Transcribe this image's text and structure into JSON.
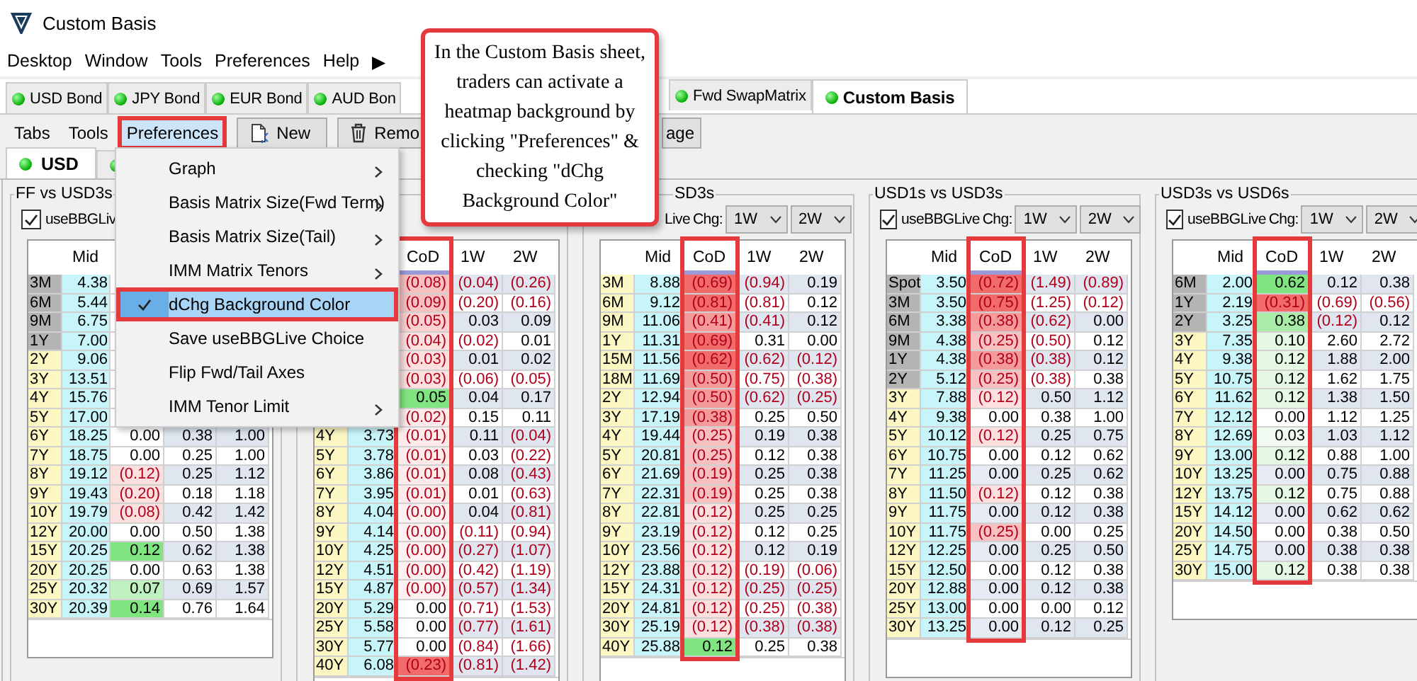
{
  "window": {
    "title": "Custom Basis"
  },
  "menubar": [
    "Desktop",
    "Window",
    "Tools",
    "Preferences",
    "Help",
    "▶"
  ],
  "tab_groups": [
    [
      {
        "label": "USD Bond",
        "selected": false
      },
      {
        "label": "JPY Bond",
        "selected": false
      },
      {
        "label": "EUR Bond",
        "selected": false
      },
      {
        "label": "AUD Bon",
        "selected": false
      }
    ],
    [
      {
        "label": "Fwd SwapMatrix",
        "selected": false
      },
      {
        "label": "Custom Basis",
        "selected": true
      }
    ]
  ],
  "toolbar": {
    "menus": [
      {
        "label": "Tabs",
        "highlighted": false
      },
      {
        "label": "Tools",
        "highlighted": false
      },
      {
        "label": "Preferences",
        "highlighted": true
      }
    ],
    "buttons": [
      {
        "label": "New",
        "kind": "new"
      },
      {
        "label": "Remo",
        "kind": "trash"
      },
      {
        "label": "age",
        "kind": "plain"
      }
    ]
  },
  "subtabs": [
    {
      "label": "USD",
      "selected": true
    },
    {
      "selected": false
    }
  ],
  "panels": [
    {
      "title": "FF vs USD3s",
      "title_cut": false,
      "checkbox": {
        "label": "useBBGLiv",
        "checked": true
      },
      "headers": {
        "mid": "Mid"
      },
      "cod_highlighted": false,
      "rows": [
        {
          "tenor": "3M",
          "kind": "money",
          "mid": "4.38"
        },
        {
          "tenor": "6M",
          "kind": "money",
          "mid": "5.44"
        },
        {
          "tenor": "9M",
          "kind": "money",
          "mid": "6.75"
        },
        {
          "tenor": "1Y",
          "kind": "money",
          "mid": "7.00"
        },
        {
          "tenor": "2Y",
          "kind": "swap",
          "mid": "9.06"
        },
        {
          "tenor": "3Y",
          "kind": "swap",
          "mid": "13.51"
        },
        {
          "tenor": "4Y",
          "kind": "swap",
          "mid": "15.76"
        },
        {
          "tenor": "5Y",
          "kind": "swap",
          "mid": "17.00"
        },
        {
          "tenor": "6Y",
          "kind": "swap",
          "mid": "18.25",
          "cod": "0.00",
          "color": "#ffffff",
          "w1": "0.38",
          "w2": "1.00",
          "neg": [
            false,
            false,
            false
          ]
        },
        {
          "tenor": "7Y",
          "kind": "swap",
          "mid": "18.75",
          "cod": "0.00",
          "color": "#ffffff",
          "w1": "0.25",
          "w2": "1.00",
          "neg": [
            false,
            false,
            false
          ]
        },
        {
          "tenor": "8Y",
          "kind": "swap",
          "mid": "19.12",
          "cod": "(0.12)",
          "color": "#fce0e0",
          "w1": "0.25",
          "w2": "1.12",
          "neg": [
            true,
            false,
            false
          ]
        },
        {
          "tenor": "9Y",
          "kind": "swap",
          "mid": "19.43",
          "cod": "(0.20)",
          "color": "#fce0e0",
          "w1": "0.18",
          "w2": "1.18",
          "neg": [
            true,
            false,
            false
          ]
        },
        {
          "tenor": "10Y",
          "kind": "swap",
          "mid": "19.79",
          "cod": "(0.08)",
          "color": "#fce0e0",
          "w1": "0.42",
          "w2": "1.42",
          "neg": [
            true,
            false,
            false
          ]
        },
        {
          "tenor": "12Y",
          "kind": "swap",
          "mid": "20.00",
          "cod": "0.00",
          "color": "#ffffff",
          "w1": "0.50",
          "w2": "1.38",
          "neg": [
            false,
            false,
            false
          ]
        },
        {
          "tenor": "15Y",
          "kind": "swap",
          "mid": "20.25",
          "cod": "0.12",
          "color": "#80e480",
          "w1": "0.62",
          "w2": "1.38",
          "neg": [
            false,
            false,
            false
          ]
        },
        {
          "tenor": "20Y",
          "kind": "swap",
          "mid": "20.25",
          "cod": "0.00",
          "color": "#ffffff",
          "w1": "0.63",
          "w2": "1.38",
          "neg": [
            false,
            false,
            false
          ]
        },
        {
          "tenor": "25Y",
          "kind": "swap",
          "mid": "20.32",
          "cod": "0.07",
          "color": "#bff0bf",
          "w1": "0.69",
          "w2": "1.57",
          "neg": [
            false,
            false,
            false
          ]
        },
        {
          "tenor": "30Y",
          "kind": "swap",
          "mid": "20.39",
          "cod": "0.14",
          "color": "#80e480",
          "w1": "0.76",
          "w2": "1.64",
          "neg": [
            false,
            false,
            false
          ]
        }
      ]
    },
    {
      "headers": {
        "cod": "CoD",
        "w1": "1W",
        "w2": "2W"
      },
      "cod_highlighted": true,
      "rows": [
        {
          "cod": "(0.08)",
          "color": "#f8c0c0",
          "w1": "(0.04)",
          "w2": "(0.26)",
          "neg": [
            true,
            true,
            true
          ]
        },
        {
          "cod": "(0.09)",
          "color": "#f8c0c0",
          "w1": "(0.20)",
          "w2": "(0.16)",
          "neg": [
            true,
            true,
            true
          ]
        },
        {
          "cod": "(0.05)",
          "color": "#fad0d0",
          "w1": "0.03",
          "w2": "0.09",
          "neg": [
            true,
            false,
            false
          ]
        },
        {
          "cod": "(0.04)",
          "color": "#fce0e0",
          "w1": "(0.02)",
          "w2": "0.01",
          "neg": [
            true,
            true,
            false
          ]
        },
        {
          "cod": "(0.03)",
          "color": "#fce0e0",
          "w1": "0.01",
          "w2": "0.02",
          "neg": [
            true,
            false,
            false
          ]
        },
        {
          "cod": "(0.03)",
          "color": "#fce0e0",
          "w1": "(0.06)",
          "w2": "(0.05)",
          "neg": [
            true,
            true,
            true
          ]
        },
        {
          "cod": "0.05",
          "color": "#80e480",
          "w1": "0.04",
          "w2": "0.17",
          "neg": [
            false,
            false,
            false
          ]
        },
        {
          "cod": "(0.02)",
          "color": "#fdeaea",
          "w1": "0.15",
          "w2": "0.11",
          "neg": [
            true,
            false,
            false
          ]
        },
        {
          "tenor": "4Y",
          "kind": "swap",
          "mid": "3.73",
          "cod": "(0.01)",
          "color": "#fdeaea",
          "w1": "0.11",
          "w2": "(0.04)",
          "neg": [
            true,
            false,
            true
          ]
        },
        {
          "tenor": "5Y",
          "kind": "swap",
          "mid": "3.78",
          "cod": "(0.01)",
          "color": "#fdeaea",
          "w1": "0.03",
          "w2": "(0.22)",
          "neg": [
            true,
            false,
            true
          ]
        },
        {
          "tenor": "6Y",
          "kind": "swap",
          "mid": "3.86",
          "cod": "(0.01)",
          "color": "#fdeaea",
          "w1": "0.08",
          "w2": "(0.43)",
          "neg": [
            true,
            false,
            true
          ]
        },
        {
          "tenor": "7Y",
          "kind": "swap",
          "mid": "3.95",
          "cod": "(0.01)",
          "color": "#fdeaea",
          "w1": "0.01",
          "w2": "(0.63)",
          "neg": [
            true,
            false,
            true
          ]
        },
        {
          "tenor": "8Y",
          "kind": "swap",
          "mid": "4.04",
          "cod": "(0.00)",
          "color": "#fdf0f0",
          "w1": "0.04",
          "w2": "(0.81)",
          "neg": [
            true,
            false,
            true
          ]
        },
        {
          "tenor": "9Y",
          "kind": "swap",
          "mid": "4.14",
          "cod": "(0.00)",
          "color": "#fdf0f0",
          "w1": "(0.11)",
          "w2": "(0.94)",
          "neg": [
            true,
            true,
            true
          ]
        },
        {
          "tenor": "10Y",
          "kind": "swap",
          "mid": "4.25",
          "cod": "(0.00)",
          "color": "#fdf0f0",
          "w1": "(0.27)",
          "w2": "(1.07)",
          "neg": [
            true,
            true,
            true
          ]
        },
        {
          "tenor": "12Y",
          "kind": "swap",
          "mid": "4.51",
          "cod": "(0.00)",
          "color": "#fdf0f0",
          "w1": "(0.42)",
          "w2": "(1.19)",
          "neg": [
            true,
            true,
            true
          ]
        },
        {
          "tenor": "15Y",
          "kind": "swap",
          "mid": "4.87",
          "cod": "(0.00)",
          "color": "#fdf0f0",
          "w1": "(0.57)",
          "w2": "(1.34)",
          "neg": [
            true,
            true,
            true
          ]
        },
        {
          "tenor": "20Y",
          "kind": "swap",
          "mid": "5.29",
          "cod": "0.00",
          "color": "#ffffff",
          "w1": "(0.71)",
          "w2": "(1.53)",
          "neg": [
            false,
            true,
            true
          ]
        },
        {
          "tenor": "25Y",
          "kind": "swap",
          "mid": "5.58",
          "cod": "0.00",
          "color": "#ffffff",
          "w1": "(0.77)",
          "w2": "(1.61)",
          "neg": [
            false,
            true,
            true
          ]
        },
        {
          "tenor": "30Y",
          "kind": "swap",
          "mid": "5.77",
          "cod": "0.00",
          "color": "#ffffff",
          "w1": "(0.84)",
          "w2": "(1.66)",
          "neg": [
            false,
            true,
            true
          ]
        },
        {
          "tenor": "40Y",
          "kind": "swap",
          "mid": "6.08",
          "cod": "(0.23)",
          "color": "#f26b6b",
          "w1": "(0.81)",
          "w2": "(1.42)",
          "neg": [
            true,
            true,
            true
          ]
        }
      ]
    },
    {
      "title": "SD3s",
      "title_cut": true,
      "checkbox": {
        "label": "Live"
      },
      "chg_label": "Chg:",
      "dropdowns": [
        "1W",
        "2W"
      ],
      "headers": {
        "mid": "Mid",
        "cod": "CoD",
        "w1": "1W",
        "w2": "2W"
      },
      "cod_highlighted": true,
      "rows": [
        {
          "tenor": "3M",
          "kind": "swap",
          "mid": "8.88",
          "cod": "(0.69)",
          "color": "#f26b6b",
          "w1": "(0.94)",
          "w2": "0.19",
          "neg": [
            true,
            true,
            false
          ]
        },
        {
          "tenor": "6M",
          "kind": "swap",
          "mid": "9.12",
          "cod": "(0.81)",
          "color": "#f26b6b",
          "w1": "(0.81)",
          "w2": "0.12",
          "neg": [
            true,
            true,
            false
          ]
        },
        {
          "tenor": "9M",
          "kind": "swap",
          "mid": "11.06",
          "cod": "(0.41)",
          "color": "#f59a9a",
          "w1": "(0.41)",
          "w2": "0.12",
          "neg": [
            true,
            true,
            false
          ]
        },
        {
          "tenor": "1Y",
          "kind": "swap",
          "mid": "11.31",
          "cod": "(0.69)",
          "color": "#f26b6b",
          "w1": "0.31",
          "w2": "0.00",
          "neg": [
            true,
            false,
            false
          ]
        },
        {
          "tenor": "15M",
          "kind": "swap",
          "mid": "11.56",
          "cod": "(0.62)",
          "color": "#f26b6b",
          "w1": "(0.62)",
          "w2": "(0.12)",
          "neg": [
            true,
            true,
            true
          ]
        },
        {
          "tenor": "18M",
          "kind": "swap",
          "mid": "11.69",
          "cod": "(0.50)",
          "color": "#f59a9a",
          "w1": "(0.75)",
          "w2": "(0.38)",
          "neg": [
            true,
            true,
            true
          ]
        },
        {
          "tenor": "2Y",
          "kind": "swap",
          "mid": "12.94",
          "cod": "(0.50)",
          "color": "#f59a9a",
          "w1": "(0.62)",
          "w2": "(0.25)",
          "neg": [
            true,
            true,
            true
          ]
        },
        {
          "tenor": "3Y",
          "kind": "swap",
          "mid": "17.19",
          "cod": "(0.38)",
          "color": "#f59a9a",
          "w1": "0.25",
          "w2": "0.50",
          "neg": [
            true,
            false,
            false
          ]
        },
        {
          "tenor": "4Y",
          "kind": "swap",
          "mid": "19.44",
          "cod": "(0.25)",
          "color": "#f8c0c0",
          "w1": "0.19",
          "w2": "0.38",
          "neg": [
            true,
            false,
            false
          ]
        },
        {
          "tenor": "5Y",
          "kind": "swap",
          "mid": "20.81",
          "cod": "(0.25)",
          "color": "#f8c0c0",
          "w1": "0.12",
          "w2": "0.38",
          "neg": [
            true,
            false,
            false
          ]
        },
        {
          "tenor": "6Y",
          "kind": "swap",
          "mid": "21.69",
          "cod": "(0.19)",
          "color": "#f8c0c0",
          "w1": "0.25",
          "w2": "0.38",
          "neg": [
            true,
            false,
            false
          ]
        },
        {
          "tenor": "7Y",
          "kind": "swap",
          "mid": "22.31",
          "cod": "(0.19)",
          "color": "#f8c0c0",
          "w1": "0.25",
          "w2": "0.38",
          "neg": [
            true,
            false,
            false
          ]
        },
        {
          "tenor": "8Y",
          "kind": "swap",
          "mid": "22.81",
          "cod": "(0.12)",
          "color": "#fce0e0",
          "w1": "0.25",
          "w2": "0.25",
          "neg": [
            true,
            false,
            false
          ]
        },
        {
          "tenor": "9Y",
          "kind": "swap",
          "mid": "23.19",
          "cod": "(0.12)",
          "color": "#fce0e0",
          "w1": "0.12",
          "w2": "0.25",
          "neg": [
            true,
            false,
            false
          ]
        },
        {
          "tenor": "10Y",
          "kind": "swap",
          "mid": "23.56",
          "cod": "(0.12)",
          "color": "#fce0e0",
          "w1": "0.12",
          "w2": "0.19",
          "neg": [
            true,
            false,
            false
          ]
        },
        {
          "tenor": "12Y",
          "kind": "swap",
          "mid": "23.88",
          "cod": "(0.12)",
          "color": "#fce0e0",
          "w1": "(0.19)",
          "w2": "(0.06)",
          "neg": [
            true,
            true,
            true
          ]
        },
        {
          "tenor": "15Y",
          "kind": "swap",
          "mid": "24.31",
          "cod": "(0.12)",
          "color": "#fce0e0",
          "w1": "(0.25)",
          "w2": "(0.25)",
          "neg": [
            true,
            true,
            true
          ]
        },
        {
          "tenor": "20Y",
          "kind": "swap",
          "mid": "24.81",
          "cod": "(0.12)",
          "color": "#fce0e0",
          "w1": "(0.25)",
          "w2": "(0.38)",
          "neg": [
            true,
            true,
            true
          ]
        },
        {
          "tenor": "30Y",
          "kind": "swap",
          "mid": "25.19",
          "cod": "(0.12)",
          "color": "#fce0e0",
          "w1": "(0.38)",
          "w2": "(0.38)",
          "neg": [
            true,
            true,
            true
          ]
        },
        {
          "tenor": "40Y",
          "kind": "swap",
          "mid": "25.88",
          "cod": "0.12",
          "color": "#80e480",
          "w1": "0.25",
          "w2": "0.38",
          "neg": [
            false,
            false,
            false
          ]
        }
      ]
    },
    {
      "title": "USD1s vs USD3s",
      "title_cut": false,
      "checkbox": {
        "label": "useBBGLive",
        "checked": true
      },
      "chg_label": "Chg:",
      "dropdowns": [
        "1W",
        "2W"
      ],
      "headers": {
        "mid": "Mid",
        "cod": "CoD",
        "w1": "1W",
        "w2": "2W"
      },
      "cod_highlighted": true,
      "rows": [
        {
          "tenor": "Spot",
          "kind": "money",
          "mid": "3.50",
          "cod": "(0.72)",
          "color": "#f26b6b",
          "w1": "(1.49)",
          "w2": "(0.89)",
          "neg": [
            true,
            true,
            true
          ]
        },
        {
          "tenor": "3M",
          "kind": "money",
          "mid": "3.50",
          "cod": "(0.75)",
          "color": "#f26b6b",
          "w1": "(1.25)",
          "w2": "(0.12)",
          "neg": [
            true,
            true,
            true
          ]
        },
        {
          "tenor": "6M",
          "kind": "money",
          "mid": "3.38",
          "cod": "(0.38)",
          "color": "#f59a9a",
          "w1": "(0.62)",
          "w2": "0.00",
          "neg": [
            true,
            true,
            false
          ]
        },
        {
          "tenor": "9M",
          "kind": "money",
          "mid": "4.38",
          "cod": "(0.25)",
          "color": "#f8c0c0",
          "w1": "(0.50)",
          "w2": "0.12",
          "neg": [
            true,
            true,
            false
          ]
        },
        {
          "tenor": "1Y",
          "kind": "money",
          "mid": "4.38",
          "cod": "(0.38)",
          "color": "#f59a9a",
          "w1": "(0.38)",
          "w2": "0.12",
          "neg": [
            true,
            true,
            false
          ]
        },
        {
          "tenor": "2Y",
          "kind": "money",
          "mid": "5.12",
          "cod": "(0.25)",
          "color": "#f8c0c0",
          "w1": "(0.38)",
          "w2": "0.38",
          "neg": [
            true,
            true,
            false
          ]
        },
        {
          "tenor": "3Y",
          "kind": "swap",
          "mid": "7.88",
          "cod": "(0.12)",
          "color": "#fce0e0",
          "w1": "0.50",
          "w2": "1.12",
          "neg": [
            true,
            false,
            false
          ]
        },
        {
          "tenor": "4Y",
          "kind": "swap",
          "mid": "9.38",
          "cod": "0.00",
          "color": "#ffffff",
          "w1": "0.38",
          "w2": "1.00",
          "neg": [
            false,
            false,
            false
          ]
        },
        {
          "tenor": "5Y",
          "kind": "swap",
          "mid": "10.12",
          "cod": "(0.12)",
          "color": "#fce0e0",
          "w1": "0.25",
          "w2": "0.75",
          "neg": [
            true,
            false,
            false
          ]
        },
        {
          "tenor": "6Y",
          "kind": "swap",
          "mid": "10.75",
          "cod": "0.00",
          "color": "#ffffff",
          "w1": "0.12",
          "w2": "0.62",
          "neg": [
            false,
            false,
            false
          ]
        },
        {
          "tenor": "7Y",
          "kind": "swap",
          "mid": "11.25",
          "cod": "0.00",
          "color": "#e6ebf3",
          "w1": "0.25",
          "w2": "0.62",
          "neg": [
            false,
            false,
            false
          ]
        },
        {
          "tenor": "8Y",
          "kind": "swap",
          "mid": "11.50",
          "cod": "(0.12)",
          "color": "#fce0e0",
          "w1": "0.12",
          "w2": "0.38",
          "neg": [
            true,
            false,
            false
          ]
        },
        {
          "tenor": "9Y",
          "kind": "swap",
          "mid": "11.75",
          "cod": "0.00",
          "color": "#e6ebf3",
          "w1": "0.12",
          "w2": "0.38",
          "neg": [
            false,
            false,
            false
          ]
        },
        {
          "tenor": "10Y",
          "kind": "swap",
          "mid": "11.75",
          "cod": "(0.25)",
          "color": "#f8c0c0",
          "w1": "0.00",
          "w2": "0.25",
          "neg": [
            true,
            false,
            false
          ]
        },
        {
          "tenor": "12Y",
          "kind": "swap",
          "mid": "12.25",
          "cod": "0.00",
          "color": "#e6ebf3",
          "w1": "0.25",
          "w2": "0.50",
          "neg": [
            false,
            false,
            false
          ]
        },
        {
          "tenor": "15Y",
          "kind": "swap",
          "mid": "12.50",
          "cod": "0.00",
          "color": "#ffffff",
          "w1": "0.12",
          "w2": "0.38",
          "neg": [
            false,
            false,
            false
          ]
        },
        {
          "tenor": "20Y",
          "kind": "swap",
          "mid": "12.88",
          "cod": "0.00",
          "color": "#e6ebf3",
          "w1": "0.12",
          "w2": "0.38",
          "neg": [
            false,
            false,
            false
          ]
        },
        {
          "tenor": "25Y",
          "kind": "swap",
          "mid": "13.00",
          "cod": "0.00",
          "color": "#ffffff",
          "w1": "0.00",
          "w2": "0.12",
          "neg": [
            false,
            false,
            false
          ]
        },
        {
          "tenor": "30Y",
          "kind": "swap",
          "mid": "13.25",
          "cod": "0.00",
          "color": "#e6ebf3",
          "w1": "0.12",
          "w2": "0.25",
          "neg": [
            false,
            false,
            false
          ]
        }
      ]
    },
    {
      "title": "USD3s vs USD6s",
      "title_cut": false,
      "checkbox": {
        "label": "useBBGLive",
        "checked": true
      },
      "chg_label": "Chg:",
      "dropdowns": [
        "1W",
        "2W"
      ],
      "headers": {
        "mid": "Mid",
        "cod": "CoD",
        "w1": "1W",
        "w2": "2W"
      },
      "cod_highlighted": true,
      "rows": [
        {
          "tenor": "6M",
          "kind": "money",
          "mid": "2.00",
          "cod": "0.62",
          "color": "#80e480",
          "w1": "0.12",
          "w2": "0.38",
          "neg": [
            false,
            false,
            false
          ]
        },
        {
          "tenor": "1Y",
          "kind": "money",
          "mid": "2.19",
          "cod": "(0.31)",
          "color": "#f26b6b",
          "w1": "(0.69)",
          "w2": "(0.56)",
          "neg": [
            true,
            true,
            true
          ]
        },
        {
          "tenor": "2Y",
          "kind": "money",
          "mid": "3.25",
          "cod": "0.38",
          "color": "#a8eca8",
          "w1": "(0.12)",
          "w2": "0.12",
          "neg": [
            false,
            true,
            false
          ]
        },
        {
          "tenor": "3Y",
          "kind": "swap",
          "mid": "7.35",
          "cod": "0.10",
          "color": "#e4f8e4",
          "w1": "2.60",
          "w2": "2.72",
          "neg": [
            false,
            false,
            false
          ]
        },
        {
          "tenor": "4Y",
          "kind": "swap",
          "mid": "9.38",
          "cod": "0.12",
          "color": "#e4f8e4",
          "w1": "1.88",
          "w2": "2.00",
          "neg": [
            false,
            false,
            false
          ]
        },
        {
          "tenor": "5Y",
          "kind": "swap",
          "mid": "10.75",
          "cod": "0.12",
          "color": "#e4f8e4",
          "w1": "1.62",
          "w2": "1.75",
          "neg": [
            false,
            false,
            false
          ]
        },
        {
          "tenor": "6Y",
          "kind": "swap",
          "mid": "11.62",
          "cod": "0.12",
          "color": "#e4f8e4",
          "w1": "1.38",
          "w2": "1.50",
          "neg": [
            false,
            false,
            false
          ]
        },
        {
          "tenor": "7Y",
          "kind": "swap",
          "mid": "12.12",
          "cod": "0.00",
          "color": "#ffffff",
          "w1": "1.12",
          "w2": "1.25",
          "neg": [
            false,
            false,
            false
          ]
        },
        {
          "tenor": "8Y",
          "kind": "swap",
          "mid": "12.69",
          "cod": "0.03",
          "color": "#f2fbf2",
          "w1": "1.03",
          "w2": "1.12",
          "neg": [
            false,
            false,
            false
          ]
        },
        {
          "tenor": "9Y",
          "kind": "swap",
          "mid": "13.00",
          "cod": "0.12",
          "color": "#e4f8e4",
          "w1": "0.88",
          "w2": "1.00",
          "neg": [
            false,
            false,
            false
          ]
        },
        {
          "tenor": "10Y",
          "kind": "swap",
          "mid": "13.25",
          "cod": "0.00",
          "color": "#e6ebf3",
          "w1": "0.75",
          "w2": "0.88",
          "neg": [
            false,
            false,
            false
          ]
        },
        {
          "tenor": "12Y",
          "kind": "swap",
          "mid": "13.75",
          "cod": "0.12",
          "color": "#e4f8e4",
          "w1": "0.75",
          "w2": "0.88",
          "neg": [
            false,
            false,
            false
          ]
        },
        {
          "tenor": "15Y",
          "kind": "swap",
          "mid": "14.12",
          "cod": "0.00",
          "color": "#e6ebf3",
          "w1": "0.62",
          "w2": "0.62",
          "neg": [
            false,
            false,
            false
          ]
        },
        {
          "tenor": "20Y",
          "kind": "swap",
          "mid": "14.50",
          "cod": "0.00",
          "color": "#ffffff",
          "w1": "0.38",
          "w2": "0.50",
          "neg": [
            false,
            false,
            false
          ]
        },
        {
          "tenor": "25Y",
          "kind": "swap",
          "mid": "14.75",
          "cod": "0.00",
          "color": "#e6ebf3",
          "w1": "0.38",
          "w2": "0.38",
          "neg": [
            false,
            false,
            false
          ]
        },
        {
          "tenor": "30Y",
          "kind": "swap",
          "mid": "15.00",
          "cod": "0.12",
          "color": "#e4f8e4",
          "w1": "0.38",
          "w2": "0.38",
          "neg": [
            false,
            false,
            false
          ]
        }
      ]
    }
  ],
  "dropdown_menu": {
    "items": [
      {
        "label": "Graph",
        "submenu": true,
        "checked": false,
        "selected": false,
        "highlighted": false
      },
      {
        "label": "Basis Matrix Size(Fwd Term)",
        "submenu": true,
        "checked": false,
        "selected": false,
        "highlighted": false
      },
      {
        "label": "Basis Matrix Size(Tail)",
        "submenu": true,
        "checked": false,
        "selected": false,
        "highlighted": false
      },
      {
        "label": "IMM Matrix Tenors",
        "submenu": true,
        "checked": false,
        "selected": false,
        "highlighted": false
      },
      {
        "label": "dChg Background Color",
        "submenu": false,
        "checked": true,
        "selected": true,
        "highlighted": true
      },
      {
        "label": "Save useBBGLive Choice",
        "submenu": false,
        "checked": false,
        "selected": false,
        "highlighted": false
      },
      {
        "label": "Flip Fwd/Tail Axes",
        "submenu": false,
        "checked": false,
        "selected": false,
        "highlighted": false
      },
      {
        "label": "IMM Tenor Limit",
        "submenu": true,
        "checked": false,
        "selected": false,
        "highlighted": false
      }
    ]
  },
  "callout": {
    "text": "In the Custom Basis sheet, traders can activate a heatmap background by clicking \"Preferences\" & checking \"dChg Background Color\""
  }
}
